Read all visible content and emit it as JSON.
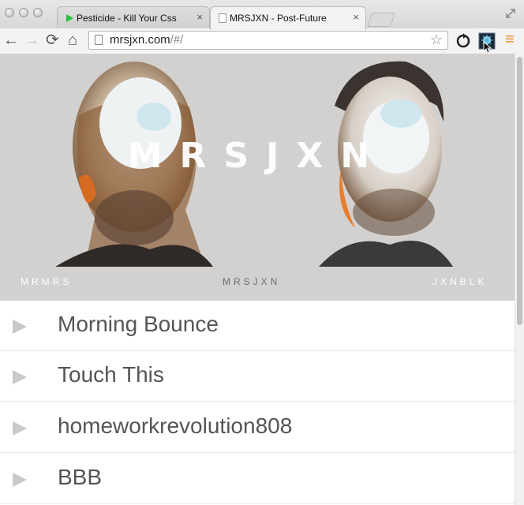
{
  "browser": {
    "tabs": [
      {
        "title": "Pesticide - Kill Your Css L"
      },
      {
        "title": "MRSJXN - Post-Future"
      }
    ],
    "close_glyph": "×",
    "address": {
      "domain": "mrsjxn.com",
      "path": "/#/"
    },
    "icons": {
      "back": "←",
      "forward": "→",
      "reload": "⟳",
      "home": "⌂",
      "star": "☆",
      "menu": "≡"
    }
  },
  "hero": {
    "title": "MRSJXN",
    "left_label": "MRMRS",
    "center_label": "MRSJXN",
    "right_label": "JXNBLK",
    "background_color": "#d3d1cf"
  },
  "tracks": [
    {
      "name": "Morning Bounce"
    },
    {
      "name": "Touch This"
    },
    {
      "name": "homeworkrevolution808"
    },
    {
      "name": "BBB"
    }
  ]
}
